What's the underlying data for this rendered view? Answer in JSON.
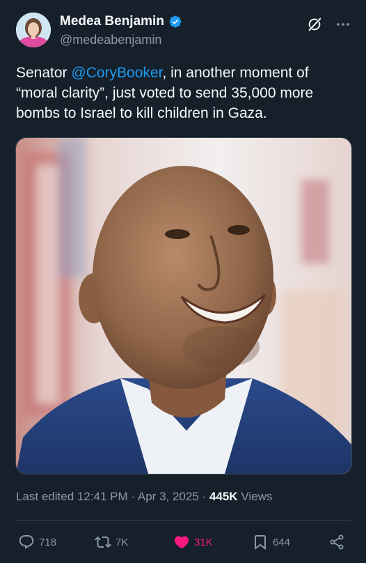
{
  "author": {
    "display_name": "Medea Benjamin",
    "handle": "@medeabenjamin",
    "verified": true
  },
  "tweet": {
    "text_before": "Senator ",
    "mention": "@CoryBooker",
    "text_after": ", in another moment of “moral clarity”, just voted to send 35,000 more bombs to Israel to kill children in Gaza."
  },
  "meta": {
    "edited_label": "Last edited",
    "time": "12:41 PM",
    "separator": "·",
    "date": "Apr 3, 2025",
    "views_count": "445K",
    "views_label": "Views"
  },
  "actions": {
    "replies": "718",
    "reposts": "7K",
    "likes": "31K",
    "bookmarks": "644"
  },
  "icons": {
    "header": [
      "grok-icon",
      "more-icon"
    ],
    "actions": [
      "reply-icon",
      "repost-icon",
      "like-icon",
      "bookmark-icon",
      "share-icon"
    ]
  },
  "colors": {
    "background": "#15202b",
    "text": "#f7f9f9",
    "secondary_text": "#8b98a5",
    "link": "#1d9bf0",
    "like_active": "#f91880",
    "verified_badge": "#1d9bf0",
    "divider": "#38444d"
  }
}
